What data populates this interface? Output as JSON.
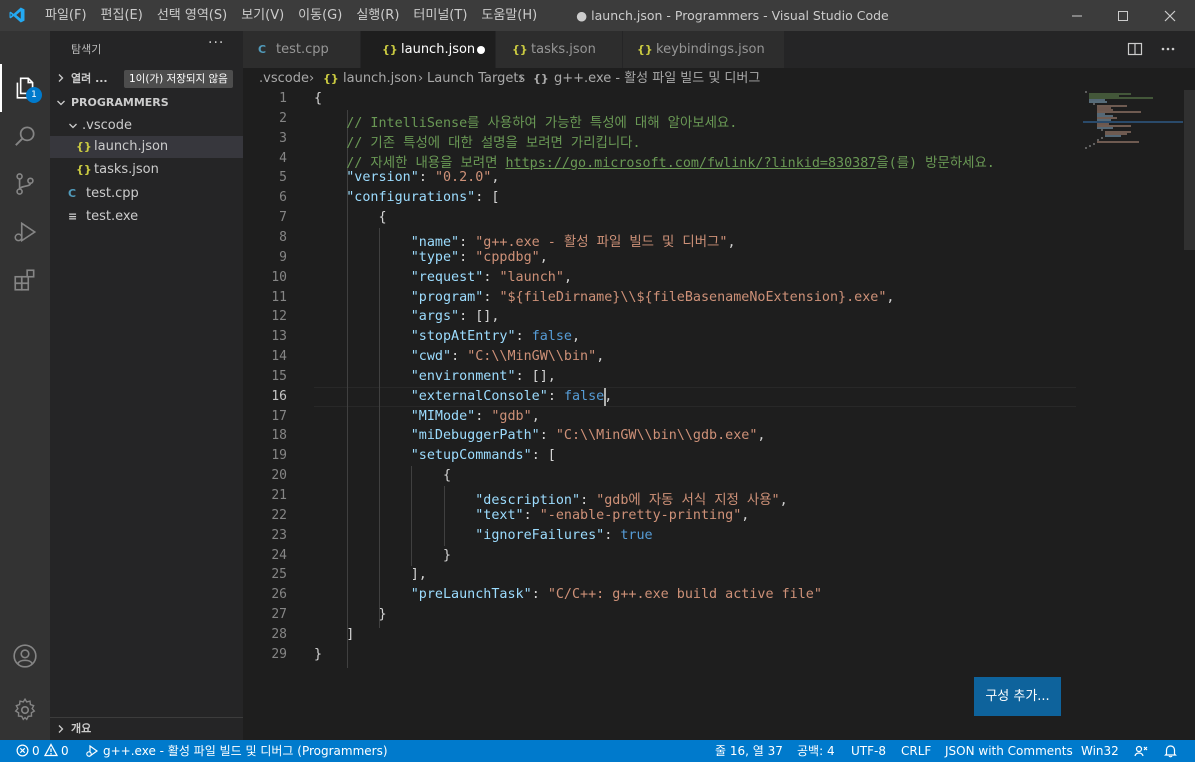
{
  "colors": {
    "accent": "#007acc",
    "titlebar": "#3c3c3c",
    "editor_bg": "#1e1e1e",
    "sidebar_bg": "#252526",
    "activity_bg": "#333333",
    "button": "#0e639c"
  },
  "menu": [
    "파일(F)",
    "편집(E)",
    "선택 영역(S)",
    "보기(V)",
    "이동(G)",
    "실행(R)",
    "터미널(T)",
    "도움말(H)"
  ],
  "window_title": "● launch.json - Programmers - Visual Studio Code",
  "activity": {
    "explorer_badge": "1",
    "icons": [
      "files-icon",
      "search-icon",
      "source-control-icon",
      "run-debug-icon",
      "extensions-icon",
      "account-icon",
      "settings-gear-icon"
    ]
  },
  "sidebar": {
    "title": "탐색기",
    "more": "···",
    "open_editors": {
      "label": "열려 ...",
      "badge": "1이(가) 저장되지 않음"
    },
    "workspace": "PROGRAMMERS",
    "tree": [
      {
        "label": ".vscode",
        "icon": "folder-open"
      },
      {
        "label": "launch.json",
        "icon": "{}"
      },
      {
        "label": "tasks.json",
        "icon": "{}"
      },
      {
        "label": "test.cpp",
        "icon": "C"
      },
      {
        "label": "test.exe",
        "icon": "≡"
      }
    ],
    "outline": "개요"
  },
  "tabs": [
    {
      "label": "test.cpp",
      "icon": "C"
    },
    {
      "label": "launch.json",
      "icon": "{}",
      "dirty": true
    },
    {
      "label": "tasks.json",
      "icon": "{}"
    },
    {
      "label": "keybindings.json",
      "icon": "{}"
    }
  ],
  "breadcrumb": [
    ".vscode",
    "launch.json",
    "Launch Targets",
    "g++.exe - 활성 파일 빌드 및 디버그"
  ],
  "breadcrumb_sep": "›",
  "breadcrumb_icons": {
    "launch": "{}",
    "target": "{}"
  },
  "editor": {
    "current_line": 16,
    "lines": [
      {
        "n": "1",
        "text": "{"
      },
      {
        "n": "2",
        "text": "    // IntelliSense를 사용하여 가능한 특성에 대해 알아보세요."
      },
      {
        "n": "3",
        "text": "    // 기존 특성에 대한 설명을 보려면 가리킵니다."
      },
      {
        "n": "4",
        "text": "    // 자세한 내용을 보려면 https://go.microsoft.com/fwlink/?linkid=830387을(를) 방문하세요."
      },
      {
        "n": "5",
        "text": "    \"version\": \"0.2.0\","
      },
      {
        "n": "6",
        "text": "    \"configurations\": ["
      },
      {
        "n": "7",
        "text": "        {"
      },
      {
        "n": "8",
        "text": "            \"name\": \"g++.exe - 활성 파일 빌드 및 디버그\","
      },
      {
        "n": "9",
        "text": "            \"type\": \"cppdbg\","
      },
      {
        "n": "10",
        "text": "            \"request\": \"launch\","
      },
      {
        "n": "11",
        "text": "            \"program\": \"${fileDirname}\\\\${fileBasenameNoExtension}.exe\","
      },
      {
        "n": "12",
        "text": "            \"args\": [],"
      },
      {
        "n": "13",
        "text": "            \"stopAtEntry\": false,"
      },
      {
        "n": "14",
        "text": "            \"cwd\": \"C:\\\\MinGW\\\\bin\","
      },
      {
        "n": "15",
        "text": "            \"environment\": [],"
      },
      {
        "n": "16",
        "text": "            \"externalConsole\": false,"
      },
      {
        "n": "17",
        "text": "            \"MIMode\": \"gdb\","
      },
      {
        "n": "18",
        "text": "            \"miDebuggerPath\": \"C:\\\\MinGW\\\\bin\\\\gdb.exe\","
      },
      {
        "n": "19",
        "text": "            \"setupCommands\": ["
      },
      {
        "n": "20",
        "text": "                {"
      },
      {
        "n": "21",
        "text": "                    \"description\": \"gdb에 자동 서식 지정 사용\","
      },
      {
        "n": "22",
        "text": "                    \"text\": \"-enable-pretty-printing\","
      },
      {
        "n": "23",
        "text": "                    \"ignoreFailures\": true"
      },
      {
        "n": "24",
        "text": "                }"
      },
      {
        "n": "25",
        "text": "            ],"
      },
      {
        "n": "26",
        "text": "            \"preLaunchTask\": \"C/C++: g++.exe build active file\""
      },
      {
        "n": "27",
        "text": "        }"
      },
      {
        "n": "28",
        "text": "    ]"
      },
      {
        "n": "29",
        "text": "}"
      }
    ]
  },
  "add_config_button": "구성 추가...",
  "status": {
    "errors": "0",
    "warnings": "0",
    "debug_target": "g++.exe - 활성 파일 빌드 및 디버그 (Programmers)",
    "position": "줄 16, 열 37",
    "spaces": "공백: 4",
    "encoding": "UTF-8",
    "eol": "CRLF",
    "language": "JSON with Comments",
    "platform": "Win32"
  }
}
